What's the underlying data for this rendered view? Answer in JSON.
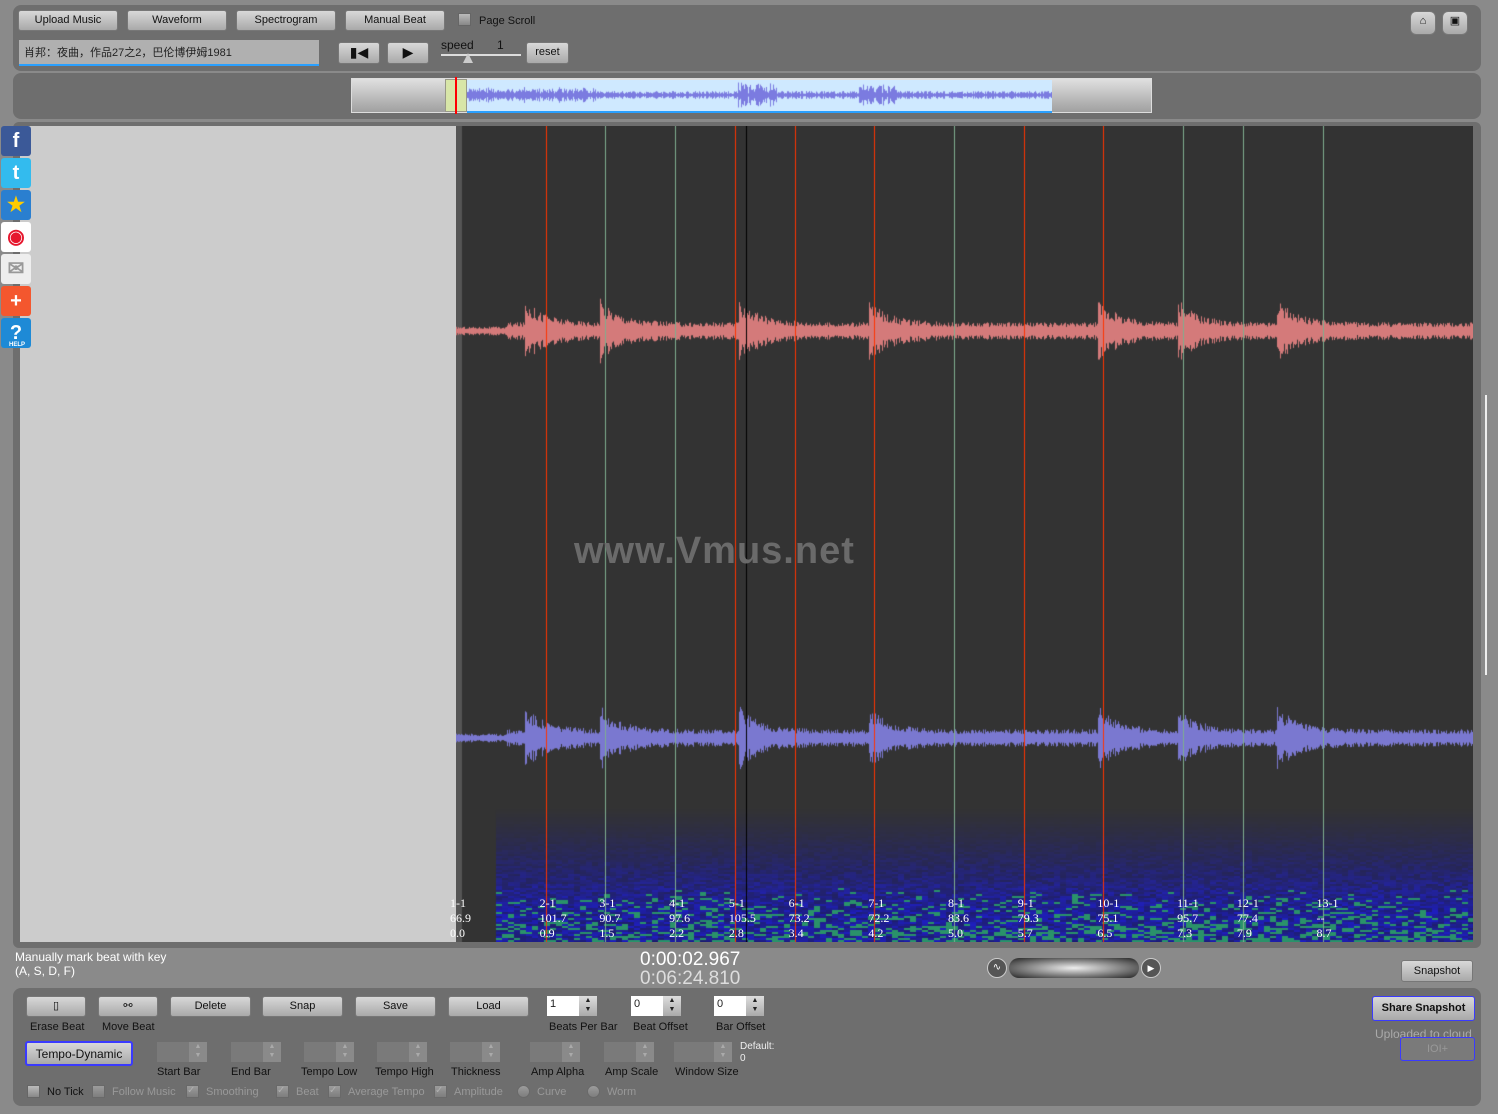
{
  "toolbar": {
    "upload": "Upload Music",
    "waveform": "Waveform",
    "spectrogram": "Spectrogram",
    "manual_beat": "Manual Beat",
    "page_scroll": "Page Scroll",
    "title_value": "肖邦：夜曲，作品27之2，巴伦博伊姆1981",
    "speed_label": "speed",
    "speed_value": "1",
    "reset": "reset"
  },
  "watermark": "www.Vmus.net",
  "social": [
    "facebook-icon",
    "twitter-icon",
    "favorite-star-icon",
    "weibo-icon",
    "email-icon",
    "add-share-icon",
    "help-icon"
  ],
  "social_help": "HELP",
  "colors": {
    "up": "#ff3300",
    "down": "#7fae8f",
    "wave_top": "#d47a7a",
    "wave_bottom": "#7a78d0",
    "playhead": "#000000"
  },
  "beats": [
    {
      "label": "1-1",
      "tempo": "66.9",
      "time": "0.0",
      "t": 0.0,
      "line": "none"
    },
    {
      "label": "2-1",
      "tempo": "101.7",
      "time": "0.9",
      "t": 0.9,
      "line": "up"
    },
    {
      "label": "3-1",
      "tempo": "90.7",
      "time": "1.5",
      "t": 1.5,
      "line": "down"
    },
    {
      "label": "4-1",
      "tempo": "97.6",
      "time": "2.2",
      "t": 2.2,
      "line": "down"
    },
    {
      "label": "5-1",
      "tempo": "105.5",
      "time": "2.8",
      "t": 2.8,
      "line": "up"
    },
    {
      "label": "6-1",
      "tempo": "73.2",
      "time": "3.4",
      "t": 3.4,
      "line": "up"
    },
    {
      "label": "7-1",
      "tempo": "72.2",
      "time": "4.2",
      "t": 4.2,
      "line": "up"
    },
    {
      "label": "8-1",
      "tempo": "83.6",
      "time": "5.0",
      "t": 5.0,
      "line": "down"
    },
    {
      "label": "9-1",
      "tempo": "79.3",
      "time": "5.7",
      "t": 5.7,
      "line": "up"
    },
    {
      "label": "10-1",
      "tempo": "75.1",
      "time": "6.5",
      "t": 6.5,
      "line": "up"
    },
    {
      "label": "11-1",
      "tempo": "95.7",
      "time": "7.3",
      "t": 7.3,
      "line": "down"
    },
    {
      "label": "12-1",
      "tempo": "77.4",
      "time": "7.9",
      "t": 7.9,
      "line": "down"
    },
    {
      "label": "13-1",
      "tempo": "--",
      "time": "8.7",
      "t": 8.7,
      "line": "down"
    }
  ],
  "playhead_time_s": 2.967,
  "status": {
    "hint1": "Manually mark beat with key",
    "hint2": "(A, S, D, F)",
    "current_time": "0:00:02.967",
    "total_time": "0:06:24.810",
    "snapshot": "Snapshot"
  },
  "controls": {
    "erase_beat": "Erase Beat",
    "move_beat": "Move Beat",
    "delete": "Delete",
    "snap": "Snap",
    "save": "Save",
    "load": "Load",
    "beats_per_bar": {
      "label": "Beats Per Bar",
      "value": "1"
    },
    "beat_offset": {
      "label": "Beat Offset",
      "value": "0"
    },
    "bar_offset": {
      "label": "Bar Offset",
      "value": "0"
    },
    "tempo_dynamic": "Tempo-Dynamic",
    "start_bar": "Start Bar",
    "end_bar": "End Bar",
    "tempo_low": "Tempo Low",
    "tempo_high": "Tempo High",
    "thickness": "Thickness",
    "amp_alpha": "Amp Alpha",
    "amp_scale": "Amp Scale",
    "window_size": "Window Size",
    "default_label": "Default:",
    "default_value": "0",
    "no_tick": "No Tick",
    "follow_music": "Follow Music",
    "smoothing": "Smoothing",
    "beat": "Beat",
    "average_tempo": "Average Tempo",
    "amplitude": "Amplitude",
    "curve": "Curve",
    "worm": "Worm",
    "share_snapshot": "Share Snapshot",
    "uploaded": "Uploaded to cloud",
    "url_btn": "IOI+"
  }
}
